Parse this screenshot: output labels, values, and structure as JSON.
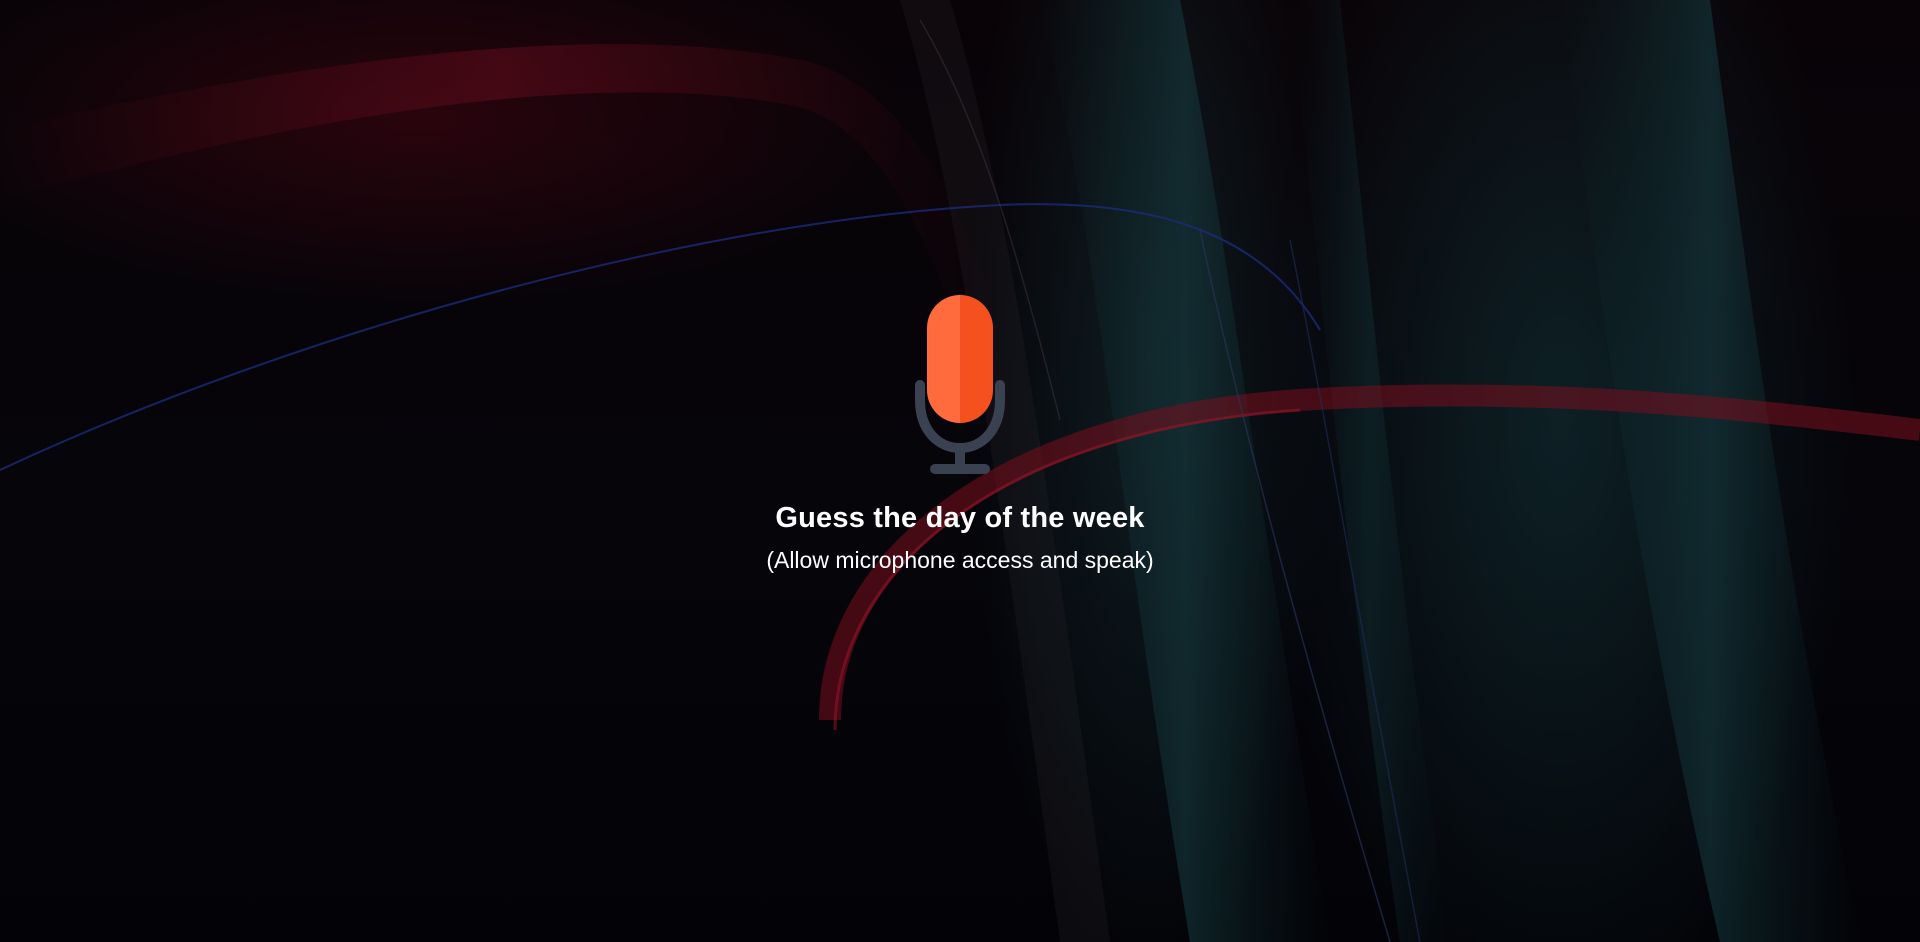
{
  "prompt": {
    "title": "Guess the day of the week",
    "subtitle": "(Allow microphone access and speak)"
  },
  "icon": {
    "name": "microphone-icon",
    "capsule_light": "#ff6b3d",
    "capsule_dark": "#f4511e",
    "stand_color": "#3a4150"
  },
  "colors": {
    "background": "#04050a",
    "text": "#ffffff"
  }
}
